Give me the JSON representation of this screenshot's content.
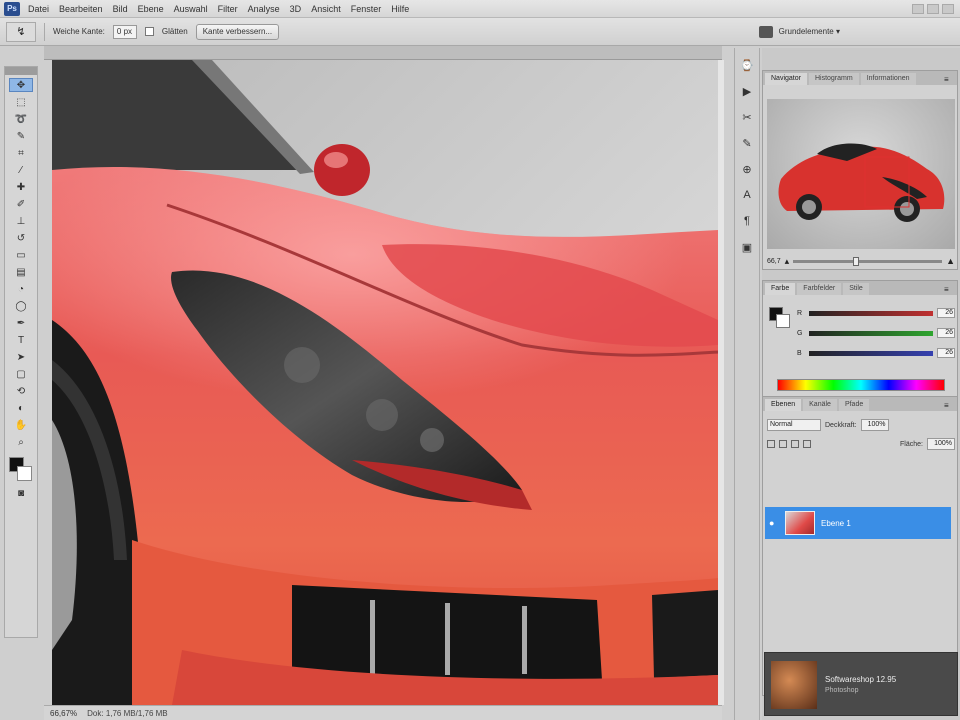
{
  "menubar": {
    "logo": "Ps",
    "items": [
      "Datei",
      "Bearbeiten",
      "Bild",
      "Ebene",
      "Auswahl",
      "Filter",
      "Analyse",
      "3D",
      "Ansicht",
      "Fenster",
      "Hilfe"
    ]
  },
  "options": {
    "tool_glyph": "↯",
    "feather_label": "Weiche Kante:",
    "feather_value": "0 px",
    "antialias_label": "Glätten",
    "refine_button": "Kante verbessern..."
  },
  "workspace": {
    "select": "Grundelemente ▾"
  },
  "statusbar": {
    "zoom": "66,67%",
    "doc": "Dok: 1,76 MB/1,76 MB"
  },
  "navigator": {
    "tabs": [
      "Navigator",
      "Histogramm",
      "Informationen"
    ],
    "zoom": "66,7"
  },
  "color": {
    "tabs": [
      "Farbe",
      "Farbfelder",
      "Stile"
    ],
    "channels": [
      {
        "name": "R",
        "value": "26",
        "color": "#c03030"
      },
      {
        "name": "G",
        "value": "26",
        "color": "#2fa52f"
      },
      {
        "name": "B",
        "value": "26",
        "color": "#3540b0"
      }
    ]
  },
  "layers": {
    "tabs": [
      "Ebenen",
      "Kanäle",
      "Pfade"
    ],
    "blend_mode": "Normal",
    "opacity_label": "Deckkraft:",
    "opacity": "100%",
    "fill_label": "Fläche:",
    "fill": "100%",
    "items": [
      {
        "name": "Ebene 1",
        "selected": true
      }
    ]
  },
  "ad": {
    "title": "Softwareshop 12.95",
    "subtitle": "Photoshop"
  }
}
